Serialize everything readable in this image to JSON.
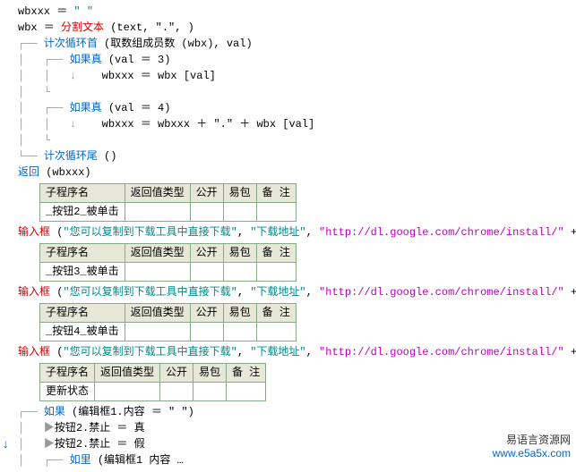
{
  "code": {
    "l1_var": "wbxxx",
    "l1_eq": " ＝ ",
    "l1_val": "\" \"",
    "l2_var": "wbx",
    "l2_eq": " ＝ ",
    "l2_fn": "分割文本",
    "l2_args": " (text, \".\", )",
    "l3_tree": "┌── ",
    "l3_kw": "计次循环首",
    "l3_args": " (取数组成员数 (wbx), val)",
    "l4_tree": "│   ┌── ",
    "l4_kw": "如果真",
    "l4_args": " (val ＝ 3)",
    "l5_tree": "│   │   ↓    ",
    "l5_txt": "wbxxx ＝ wbx [val]",
    "l6_tree": "│   └",
    "l7_tree": "│   ┌── ",
    "l7_kw": "如果真",
    "l7_args": " (val ＝ 4)",
    "l8_tree": "│   │   ↓    ",
    "l8_txt": "wbxxx ＝ wbxxx ＋ \".\" ＋ wbx [val]",
    "l9_tree": "│   └",
    "l10_tree": "└── ",
    "l10_kw": "计次循环尾",
    "l10_args": " ()",
    "l11_kw": "返回",
    "l11_args": " (wbxxx)"
  },
  "table_hdr": {
    "c1": "子程序名",
    "c2": "返回值类型",
    "c3": "公开",
    "c4": "易包",
    "c5": "备 注"
  },
  "rows": {
    "r1": "_按钮2_被单击",
    "r2": "_按钮3_被单击",
    "r3": "_按钮4_被单击",
    "r4": "更新状态"
  },
  "inputbox": {
    "kw": "输入框",
    "open": " (",
    "s1": "\"您可以复制到下载工具中直接下载\"",
    "s2": "\"下载地址\"",
    "s3": "\"http://dl.google.com/chrome/install/\"",
    "sep": ", ",
    "tail": " +"
  },
  "end": {
    "l1_tree": "┌── ",
    "l1_kw": "如果",
    "l1_args": " (编辑框1.内容 ＝ \" \")",
    "l2_tree": "│   ▶",
    "l2_txt": "按钮2.禁止 ＝ 真",
    "l3_tree": "│   ▶",
    "l3_txt": "按钮2.禁止 ＝ 假",
    "l4_tree": "│   ┌── ",
    "l4_kw": "如里",
    "l4_args": " (编辑框1 内容 …"
  },
  "watermark": {
    "cn": "易语言资源网",
    "url": "www.e5a5x.com"
  },
  "gutter": "↓"
}
